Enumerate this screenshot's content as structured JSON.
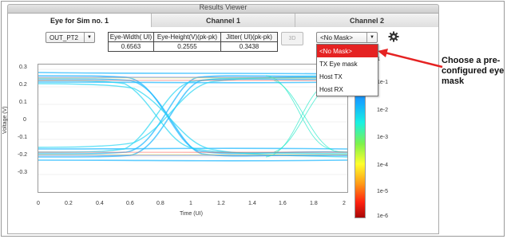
{
  "window": {
    "title": "Results Viewer"
  },
  "tabs": [
    {
      "label": "Eye for Sim no. 1",
      "active": true
    },
    {
      "label": "Channel 1",
      "active": false
    },
    {
      "label": "Channel 2",
      "active": false
    }
  ],
  "controls": {
    "probe_select": "OUT_PT2",
    "disabled_button": "3D",
    "mask_select": "<No Mask>"
  },
  "measurements": {
    "headers": [
      "Eye-Width( UI)",
      "Eye-Height(V)(pk-pk)",
      "Jitter( UI)(pk-pk)"
    ],
    "values": [
      "0.6563",
      "0.2555",
      "0.3438"
    ]
  },
  "mask_dropdown": {
    "options": [
      "<No Mask>",
      "TX Eye mask",
      "Host TX",
      "Host RX"
    ],
    "selected": "<No Mask>"
  },
  "callout": {
    "text": "Choose a pre-configured eye mask",
    "color": "#e52222"
  },
  "plot": {
    "ylabel": "Voltage (V)",
    "xlabel": "Time (UI)",
    "yticks": [
      "0.3",
      "0.2",
      "0.1",
      "0",
      "-0.1",
      "-0.2",
      "-0.3"
    ],
    "xticks": [
      "0",
      "0.2",
      "0.4",
      "0.6",
      "0.8",
      "1",
      "1.2",
      "1.4",
      "1.6",
      "1.8",
      "2"
    ]
  },
  "colorbar": {
    "ticks": [
      "1",
      "1e-1",
      "1e-2",
      "1e-3",
      "1e-4",
      "1e-5",
      "1e-6"
    ]
  },
  "colors": {
    "accent": "#e52222",
    "trace": "#1aa0ff"
  }
}
